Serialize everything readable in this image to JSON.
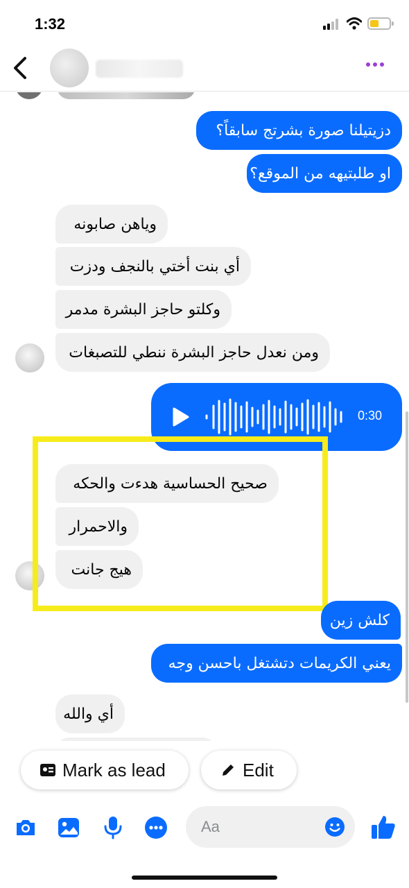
{
  "status_bar": {
    "time": "1:32",
    "battery_color": "#f5c518"
  },
  "header": {
    "back_icon": "chevron-left-icon",
    "more_icon": "more-dots-icon",
    "accent_color": "#9b3fd6"
  },
  "messages": {
    "outgoing_1": "دزيتيلنا صورة بشرتج سابقاً؟",
    "outgoing_2": "او طلبتيهه من الموقع؟",
    "incoming_1": "وياهن صابونه",
    "incoming_2": "أي بنت أختي بالنجف ودزت",
    "incoming_3": "وكلتو حاجز البشرة مدمر",
    "incoming_4": "ومن نعدل حاجز البشرة ننطي للتصبغات",
    "incoming_5": "صحيح الحساسية هدءت والحكه",
    "incoming_6": "والاحمرار",
    "incoming_7": "هيج جانت",
    "outgoing_3": "كلش زين",
    "outgoing_4": "يعني الكريمات دتشتغل باحسن وجه",
    "incoming_8": "أي والله"
  },
  "audio": {
    "duration": "0:30",
    "play_icon": "play-icon"
  },
  "actions": {
    "mark_lead_label": "Mark as lead",
    "edit_label": "Edit"
  },
  "composer": {
    "placeholder": "Aa",
    "icons": [
      "camera-icon",
      "image-icon",
      "microphone-icon",
      "chat-more-icon",
      "emoji-icon",
      "thumbs-up-icon"
    ]
  },
  "colors": {
    "outgoing_bubble": "#0a6cff",
    "incoming_bubble": "#f0f0f0",
    "highlight": "#f7ec1b",
    "icon_blue": "#0a6cff"
  }
}
